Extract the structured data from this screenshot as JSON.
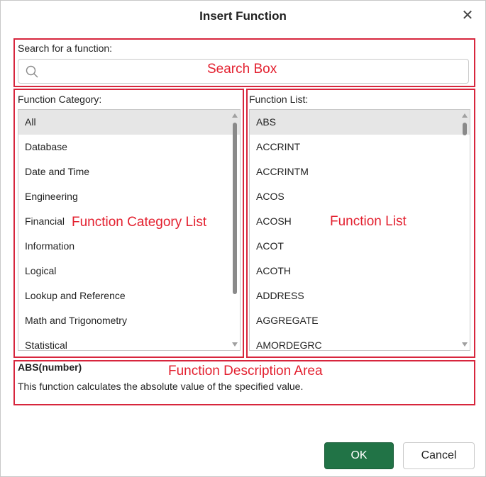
{
  "dialog": {
    "title": "Insert Function"
  },
  "search": {
    "label": "Search for a function:",
    "value": "",
    "annotation": "Search Box"
  },
  "category": {
    "label": "Function Category:",
    "annotation": "Function Category List",
    "items": [
      "All",
      "Database",
      "Date and Time",
      "Engineering",
      "Financial",
      "Information",
      "Logical",
      "Lookup and Reference",
      "Math and Trigonometry",
      "Statistical"
    ],
    "selected_index": 0
  },
  "functions": {
    "label": "Function List:",
    "annotation": "Function List",
    "items": [
      "ABS",
      "ACCRINT",
      "ACCRINTM",
      "ACOS",
      "ACOSH",
      "ACOT",
      "ACOTH",
      "ADDRESS",
      "AGGREGATE",
      "AMORDEGRC"
    ],
    "selected_index": 0
  },
  "description": {
    "annotation": "Function Description Area",
    "signature": "ABS(number)",
    "text": "This function calculates the absolute value of the specified value."
  },
  "buttons": {
    "ok": "OK",
    "cancel": "Cancel"
  },
  "colors": {
    "annotation": "#e3202f",
    "ok_button": "#217346",
    "selection": "#e6e6e6"
  }
}
